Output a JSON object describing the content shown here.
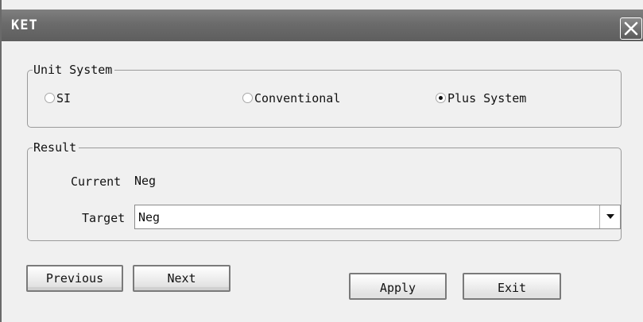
{
  "window": {
    "title": "KET"
  },
  "unit_system": {
    "legend": "Unit System",
    "options": [
      {
        "label": "SI",
        "selected": false
      },
      {
        "label": "Conventional",
        "selected": false
      },
      {
        "label": "Plus System",
        "selected": true
      }
    ]
  },
  "result": {
    "legend": "Result",
    "current_label": "Current",
    "current_value": "Neg",
    "target_label": "Target",
    "target_value": "Neg"
  },
  "buttons": {
    "previous": "Previous",
    "next": "Next",
    "apply": "Apply",
    "exit": "Exit"
  },
  "icons": {
    "close": "close-icon",
    "dropdown": "chevron-down-icon"
  }
}
